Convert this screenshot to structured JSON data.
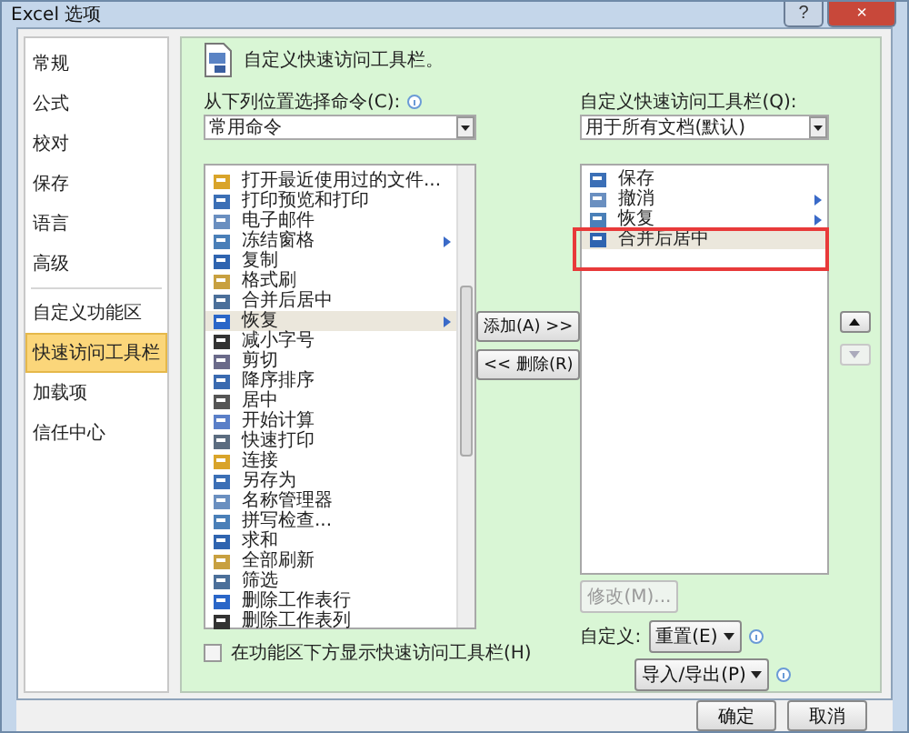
{
  "window": {
    "title": "Excel 选项",
    "help_button": "?",
    "close_button": "×"
  },
  "sidebar": {
    "items": [
      {
        "label": "常规",
        "selected": false,
        "divider_after": false
      },
      {
        "label": "公式",
        "selected": false,
        "divider_after": false
      },
      {
        "label": "校对",
        "selected": false,
        "divider_after": false
      },
      {
        "label": "保存",
        "selected": false,
        "divider_after": false
      },
      {
        "label": "语言",
        "selected": false,
        "divider_after": false
      },
      {
        "label": "高级",
        "selected": false,
        "divider_after": true
      },
      {
        "label": "自定义功能区",
        "selected": false,
        "divider_after": false
      },
      {
        "label": "快速访问工具栏",
        "selected": true,
        "divider_after": false
      },
      {
        "label": "加载项",
        "selected": false,
        "divider_after": false
      },
      {
        "label": "信任中心",
        "selected": false,
        "divider_after": false
      }
    ]
  },
  "header": {
    "title": "自定义快速访问工具栏。"
  },
  "choose_from": {
    "label": "从下列位置选择命令(C):",
    "value": "常用命令"
  },
  "commands": [
    {
      "label": "打开最近使用过的文件...",
      "selected": false,
      "submenu": false
    },
    {
      "label": "打印预览和打印",
      "selected": false,
      "submenu": false
    },
    {
      "label": "电子邮件",
      "selected": false,
      "submenu": false
    },
    {
      "label": "冻结窗格",
      "selected": false,
      "submenu": true
    },
    {
      "label": "复制",
      "selected": false,
      "submenu": false
    },
    {
      "label": "格式刷",
      "selected": false,
      "submenu": false
    },
    {
      "label": "合并后居中",
      "selected": false,
      "submenu": false
    },
    {
      "label": "恢复",
      "selected": true,
      "submenu": true
    },
    {
      "label": "减小字号",
      "selected": false,
      "submenu": false
    },
    {
      "label": "剪切",
      "selected": false,
      "submenu": false
    },
    {
      "label": "降序排序",
      "selected": false,
      "submenu": false
    },
    {
      "label": "居中",
      "selected": false,
      "submenu": false
    },
    {
      "label": "开始计算",
      "selected": false,
      "submenu": false
    },
    {
      "label": "快速打印",
      "selected": false,
      "submenu": false
    },
    {
      "label": "连接",
      "selected": false,
      "submenu": false
    },
    {
      "label": "另存为",
      "selected": false,
      "submenu": false
    },
    {
      "label": "名称管理器",
      "selected": false,
      "submenu": false
    },
    {
      "label": "拼写检查...",
      "selected": false,
      "submenu": false
    },
    {
      "label": "求和",
      "selected": false,
      "submenu": false
    },
    {
      "label": "全部刷新",
      "selected": false,
      "submenu": false
    },
    {
      "label": "筛选",
      "selected": false,
      "submenu": false
    },
    {
      "label": "删除工作表行",
      "selected": false,
      "submenu": false
    },
    {
      "label": "删除工作表列",
      "selected": false,
      "submenu": false
    }
  ],
  "add_button": "添加(A) >>",
  "remove_button": "<< 删除(R)",
  "toolbar_for": {
    "label": "自定义快速访问工具栏(Q):",
    "value": "用于所有文档(默认)"
  },
  "toolbar_items": [
    {
      "label": "保存",
      "selected": false,
      "submenu": false,
      "highlighted": false
    },
    {
      "label": "撤消",
      "selected": false,
      "submenu": true,
      "highlighted": false
    },
    {
      "label": "恢复",
      "selected": false,
      "submenu": true,
      "highlighted": false
    },
    {
      "label": "合并后居中",
      "selected": true,
      "submenu": false,
      "highlighted": true
    }
  ],
  "move_up": {
    "disabled": false
  },
  "move_down": {
    "disabled": true
  },
  "modify_button": {
    "label": "修改(M)...",
    "disabled": true
  },
  "customize": {
    "label": "自定义:",
    "reset_button": "重置(E)",
    "import_export_button": "导入/导出(P)"
  },
  "show_below_ribbon": {
    "label": "在功能区下方显示快速访问工具栏(H)",
    "checked": false
  },
  "footer": {
    "ok": "确定",
    "cancel": "取消"
  }
}
